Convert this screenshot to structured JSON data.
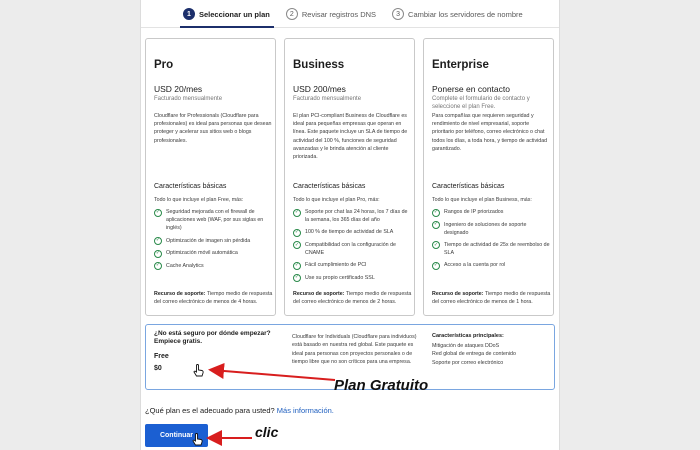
{
  "stepper": {
    "steps": [
      {
        "num": "1",
        "label": "Seleccionar un plan"
      },
      {
        "num": "2",
        "label": "Revisar registros DNS"
      },
      {
        "num": "3",
        "label": "Cambiar los servidores de nombre"
      }
    ]
  },
  "plans": [
    {
      "name": "Pro",
      "price": "USD 20/mes",
      "billing": "Facturado mensualmente",
      "description": "Cloudflare for Professionals (Cloudflare para profesionales) es ideal para personas que desean proteger y acelerar sus sitios web o blogs profesionales.",
      "features_title": "Características básicas",
      "features_intro": "Todo lo que incluye el plan Free, más:",
      "features": [
        "Seguridad mejorada con el firewall de aplicaciones web (WAF, por sus siglas en inglés)",
        "Optimización de imagen sin pérdida",
        "Optimización móvil automática",
        "Cache Analytics"
      ],
      "support_label": "Recurso de soporte:",
      "support_text": "Tiempo medio de respuesta del correo electrónico de menos de 4 horas."
    },
    {
      "name": "Business",
      "price": "USD 200/mes",
      "billing": "Facturado mensualmente",
      "description": "El plan PCI-compliant Business de Cloudflare es ideal para pequeñas empresas que operan en línea. Este paquete incluye un SLA de tiempo de actividad del 100 %, funciones de seguridad avanzadas y le brinda atención al cliente priorizada.",
      "features_title": "Características básicas",
      "features_intro": "Todo lo que incluye el plan Pro, más:",
      "features": [
        "Soporte por chat las 24 horas, los 7 días de la semana, los 365 días del año",
        "100 % de tiempo de actividad de SLA",
        "Compatibilidad con la configuración de CNAME",
        "Fácil cumplimiento de PCI",
        "Use su propio certificado SSL"
      ],
      "support_label": "Recurso de soporte:",
      "support_text": "Tiempo medio de respuesta del correo electrónico de menos de 2 horas."
    },
    {
      "name": "Enterprise",
      "price": "Ponerse en contacto",
      "billing": "Complete el formulario de contacto y seleccione el plan Free.",
      "description": "Para compañías que requieren seguridad y rendimiento de nivel empresarial, soporte prioritario por teléfono, correo electrónico o chat todos los días, a toda hora, y tiempo de actividad garantizado.",
      "features_title": "Características básicas",
      "features_intro": "Todo lo que incluye el plan Business, más:",
      "features": [
        "Rangos de IP priorizados",
        "Ingeniero de soluciones de soporte designado",
        "Tiempo de actividad de 25x de reembolso de SLA",
        "Acceso a la cuenta por rol"
      ],
      "support_label": "Recurso de soporte:",
      "support_text": "Tiempo medio de respuesta del correo electrónico de menos de 1 hora."
    }
  ],
  "free_plan": {
    "question": "¿No está seguro por dónde empezar? Empiece gratis.",
    "name": "Free",
    "price": "$0",
    "description": "Cloudflare for Individuals (Cloudflare para individuos) está basado en nuestra red global. Este paquete es ideal para personas con proyectos personales o de tiempo libre que no son críticos para una empresa.",
    "features_title": "Características principales:",
    "features": [
      "Mitigación de ataques DDoS",
      "Red global de entrega de contenido",
      "Soporte por correo electrónico"
    ]
  },
  "footer": {
    "question": "¿Qué plan es el adecuado para usted?",
    "link": "Más información."
  },
  "continue_label": "Continuar",
  "annotations": {
    "plan_gratuito": "Plan Gratuito",
    "clic": "clic"
  },
  "colors": {
    "primary_button": "#1b5fd2",
    "free_box_border": "#7aa6e0",
    "active_step": "#1c2f6b",
    "check_icon": "#2a8a4a",
    "annotation_arrow": "#d81e1e"
  },
  "icons": {
    "feature_check": "check-circle-icon",
    "pointer": "hand-pointer-icon"
  }
}
